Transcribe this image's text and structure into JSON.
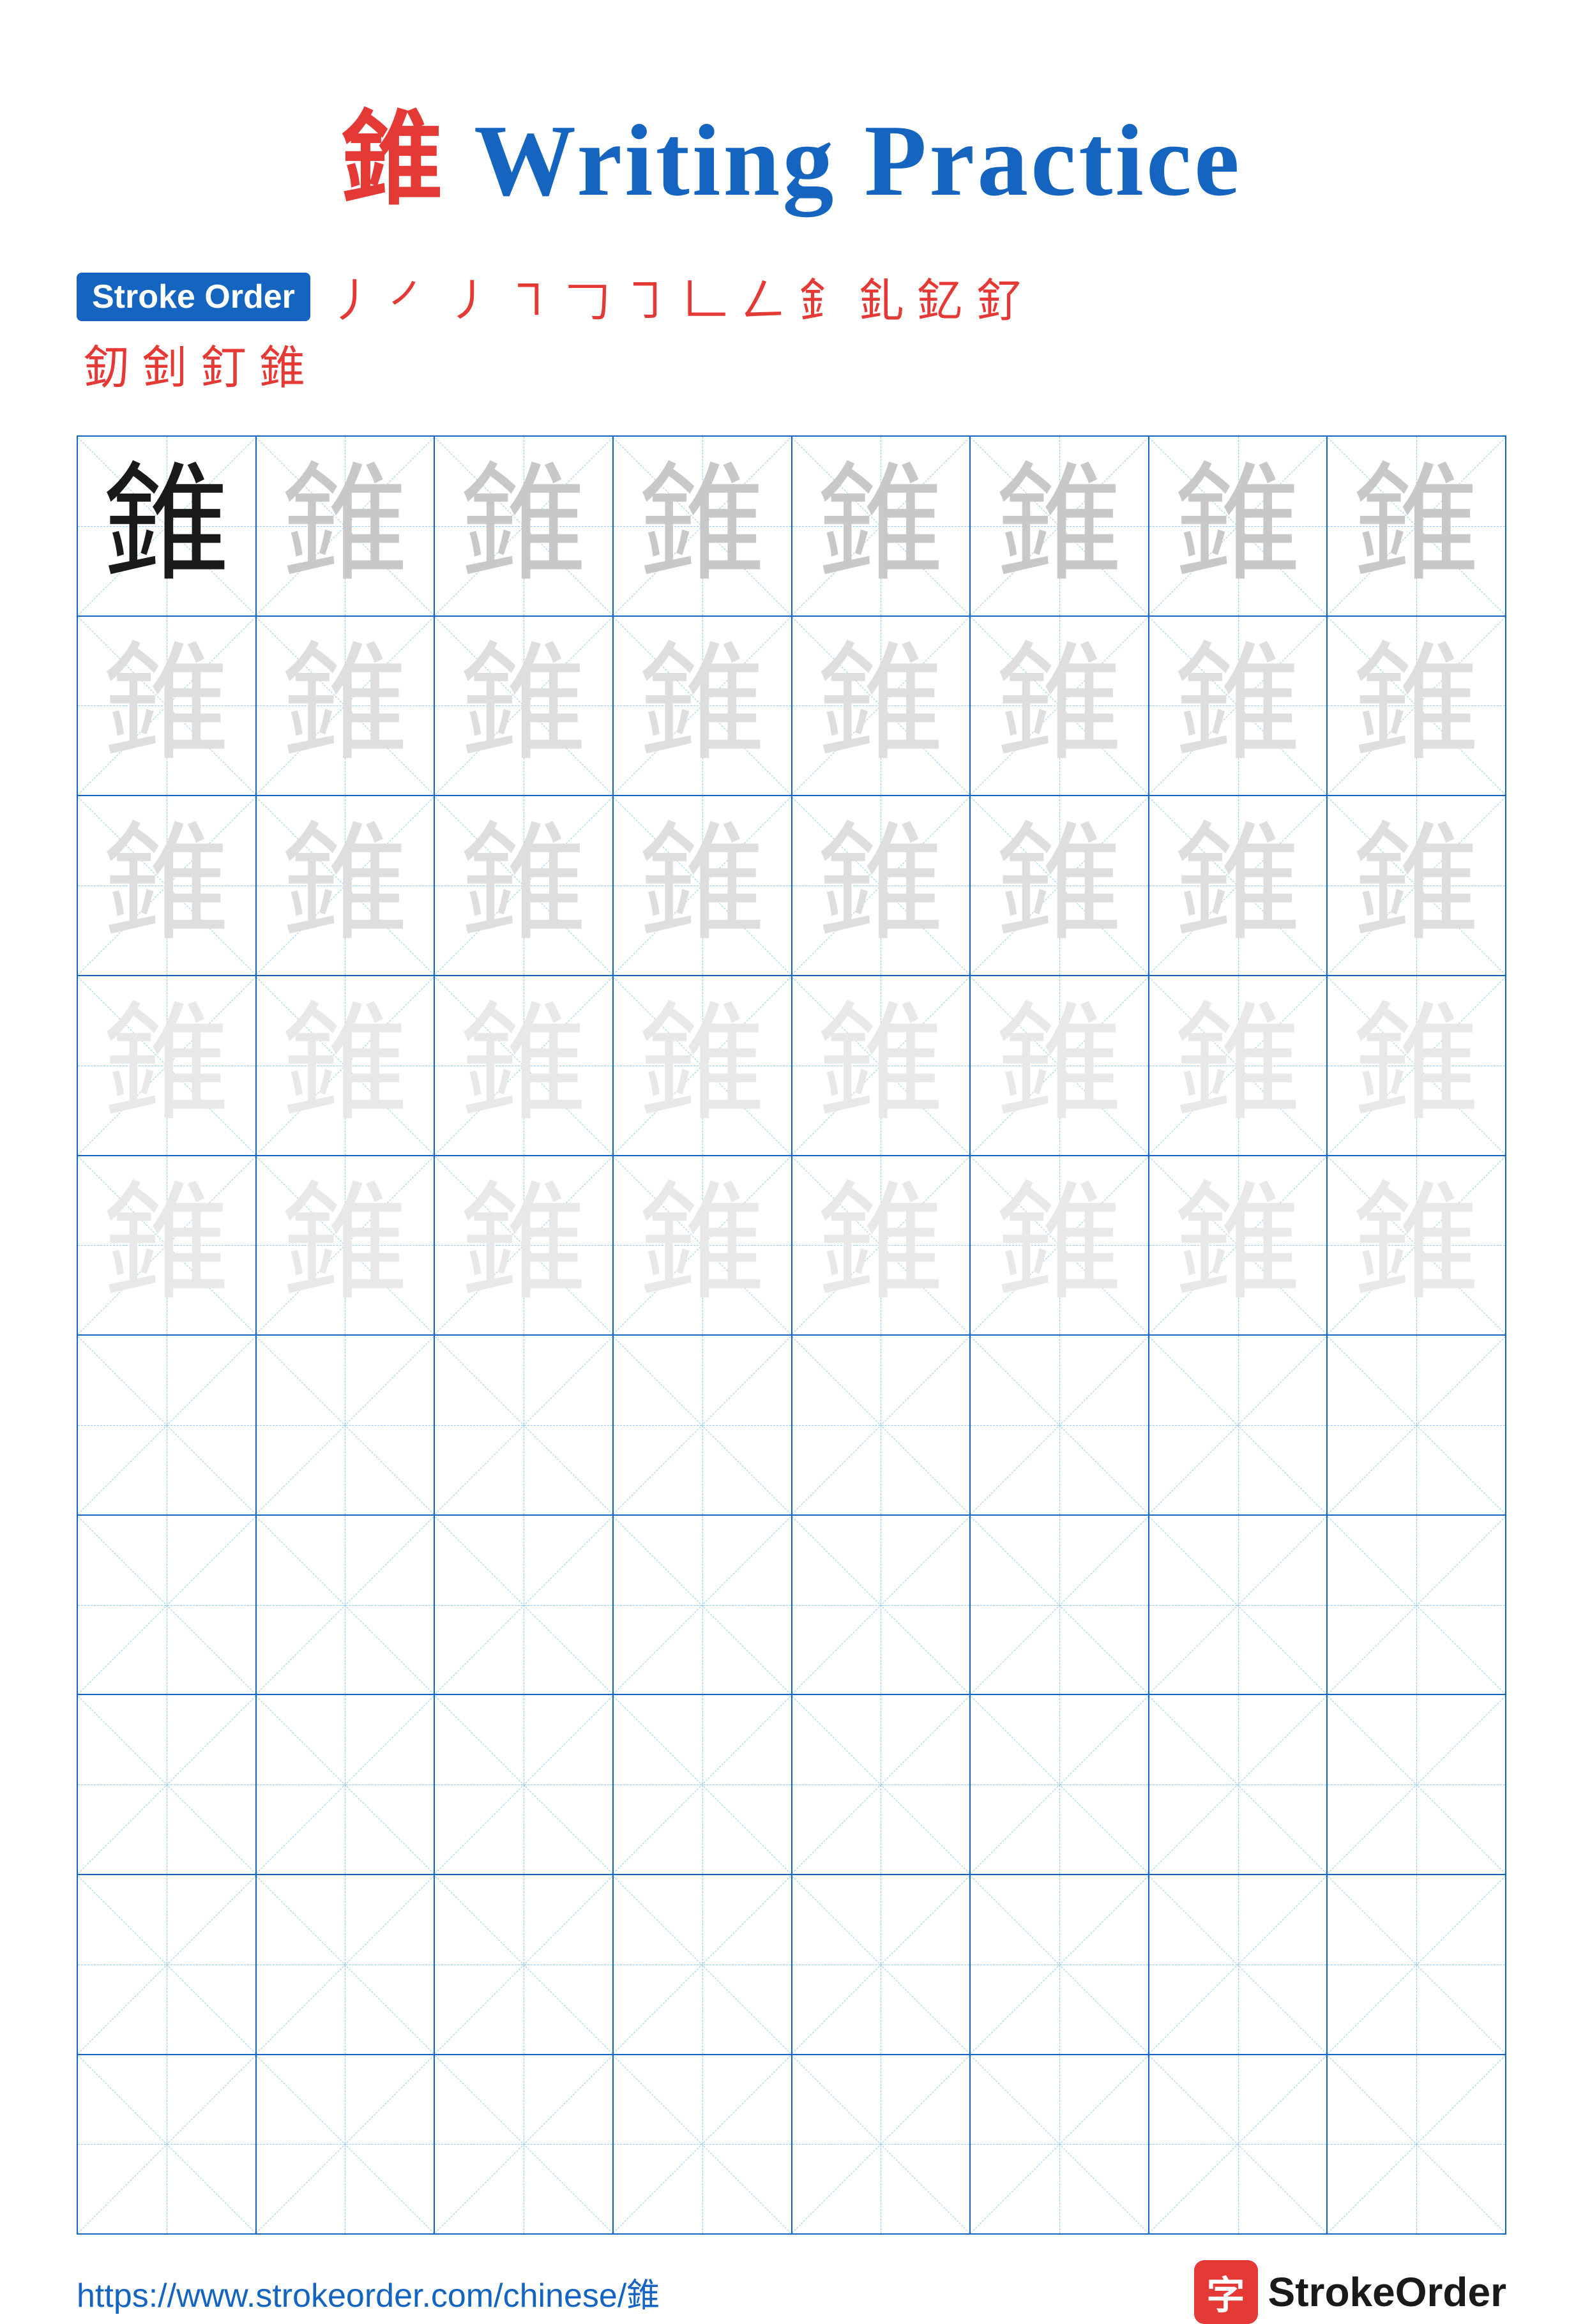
{
  "page": {
    "title": {
      "char": "錐",
      "text": " Writing Practice"
    },
    "stroke_order": {
      "badge": "Stroke Order",
      "strokes_row1": [
        "丿",
        "㇒",
        "㇓",
        "㇕",
        "𠃌",
        "㇆",
        "𠃊",
        "𠃋",
        "釒",
        "釓",
        "釔",
        "釕"
      ],
      "strokes_row2": [
        "釖",
        "釗",
        "釘",
        "錐"
      ]
    },
    "grid": {
      "char": "錐",
      "rows": 10,
      "cols": 8
    },
    "footer": {
      "url": "https://www.strokeorder.com/chinese/錐",
      "logo_char": "字",
      "logo_text": "StrokeOrder"
    }
  }
}
